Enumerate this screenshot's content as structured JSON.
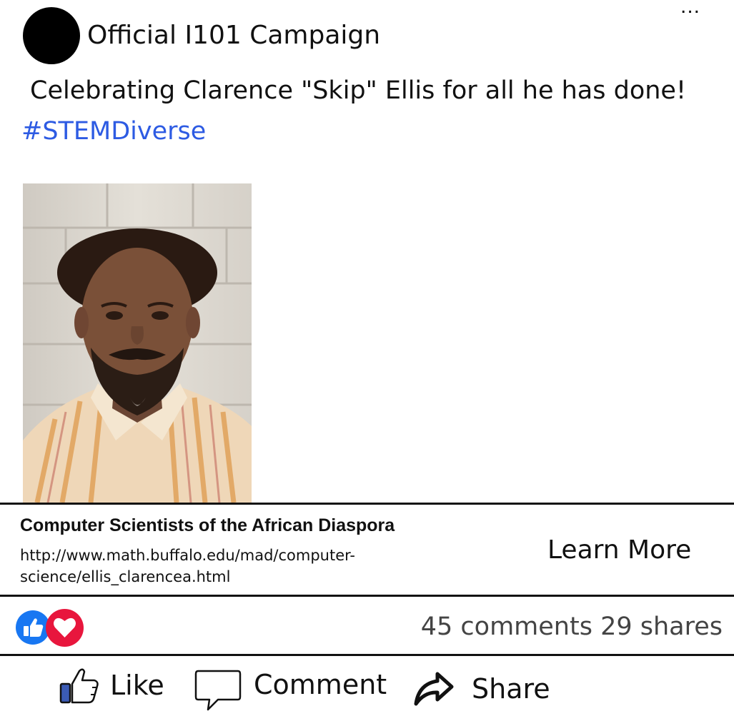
{
  "post": {
    "author": "Official I101 Campaign",
    "more_label": "...",
    "text": "Celebrating Clarence \"Skip\" Ellis for all he has done!",
    "hashtag": "#STEMDiverse"
  },
  "link_preview": {
    "title": "Computer Scientists of the African Diaspora",
    "url_line1": "http://www.math.buffalo.edu/mad/computer-",
    "url_line2": "science/ellis_clarencea.html",
    "cta_label": "Learn More"
  },
  "engagement": {
    "reactions": [
      "like-icon",
      "love-icon"
    ],
    "comments": "45 comments",
    "shares": "29 shares"
  },
  "actions": {
    "like_label": "Like",
    "comment_label": "Comment",
    "share_label": "Share"
  },
  "colors": {
    "hashtag": "#2d5be3",
    "like_reaction": "#1877f2",
    "love_reaction": "#e8163d",
    "like_thumb": "#3b5bb5"
  }
}
